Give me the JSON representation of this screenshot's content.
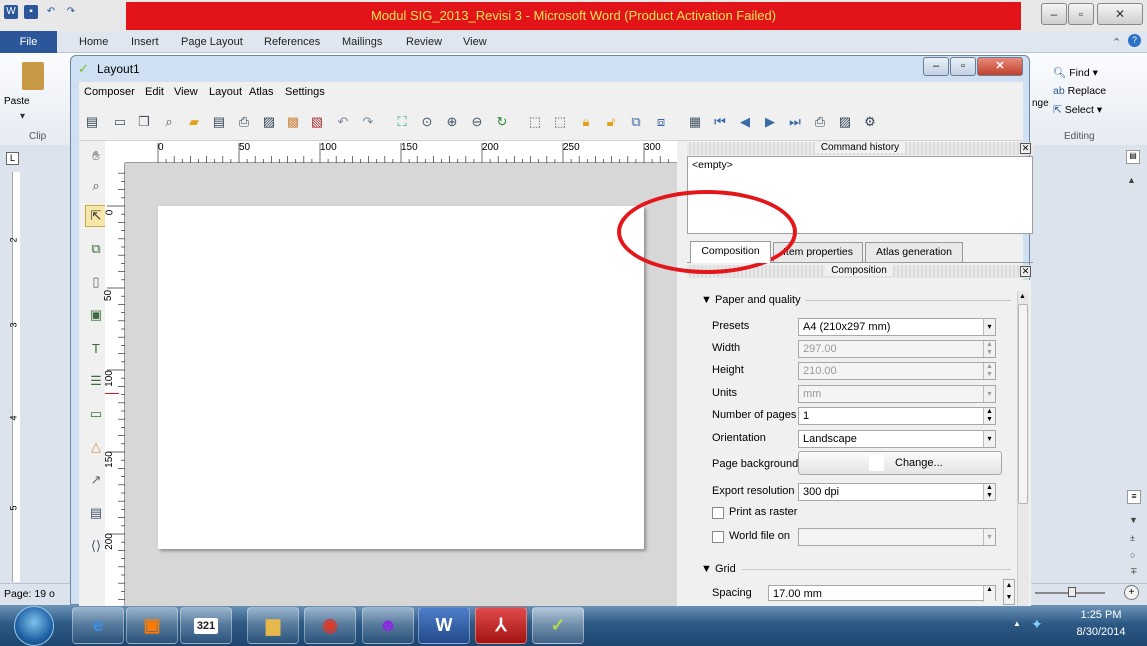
{
  "word": {
    "title": "Modul SIG_2013_Revisi 3  -  Microsoft Word (Product Activation Failed)",
    "file_tab": "File",
    "tabs": [
      "Home",
      "Insert",
      "Page Layout",
      "References",
      "Mailings",
      "Review",
      "View"
    ],
    "paste_label": "Paste",
    "clipboard_label": "Clip",
    "find_label": "Find",
    "replace_label": "Replace",
    "select_label": "Select",
    "editing_label": "Editing",
    "change_styles_label": "nge",
    "status_page": "Page: 19 o",
    "ruler_marker": "L",
    "vertical_ruler_numbers": [
      "2",
      "3",
      "4",
      "5"
    ]
  },
  "qgis": {
    "window_title": "Layout1",
    "menu": [
      "Composer",
      "Edit",
      "View",
      "Layout",
      "Atlas",
      "Settings"
    ],
    "ruler_h_labels": [
      "0",
      "50",
      "100",
      "150",
      "200",
      "250",
      "300"
    ],
    "ruler_v_labels": [
      "0",
      "50",
      "100",
      "150",
      "200"
    ],
    "command_history": {
      "title": "Command history",
      "item": "<empty>"
    },
    "tabs": [
      "Composition",
      "Item properties",
      "Atlas generation"
    ],
    "active_tab": "Composition",
    "panel_title": "Composition",
    "paper_section": "Paper and quality",
    "fields": {
      "presets_label": "Presets",
      "presets_value": "A4 (210x297 mm)",
      "width_label": "Width",
      "width_value": "297.00",
      "height_label": "Height",
      "height_value": "210.00",
      "units_label": "Units",
      "units_value": "mm",
      "pages_label": "Number of pages",
      "pages_value": "1",
      "orientation_label": "Orientation",
      "orientation_value": "Landscape",
      "background_label": "Page background",
      "background_button": "Change...",
      "resolution_label": "Export resolution",
      "resolution_value": "300 dpi",
      "print_raster_label": "Print as raster",
      "world_file_label": "World file on"
    },
    "grid_section": "Grid",
    "spacing_label": "Spacing",
    "spacing_value": "17.00 mm"
  },
  "taskbar": {
    "time": "1:25 PM",
    "date": "8/30/2014",
    "calendar_day": "321"
  },
  "colors": {
    "title_red": "#e2141a",
    "title_text": "#f2e35b",
    "annotation_red": "#e3161c",
    "taskbar": "#2d5a85"
  }
}
